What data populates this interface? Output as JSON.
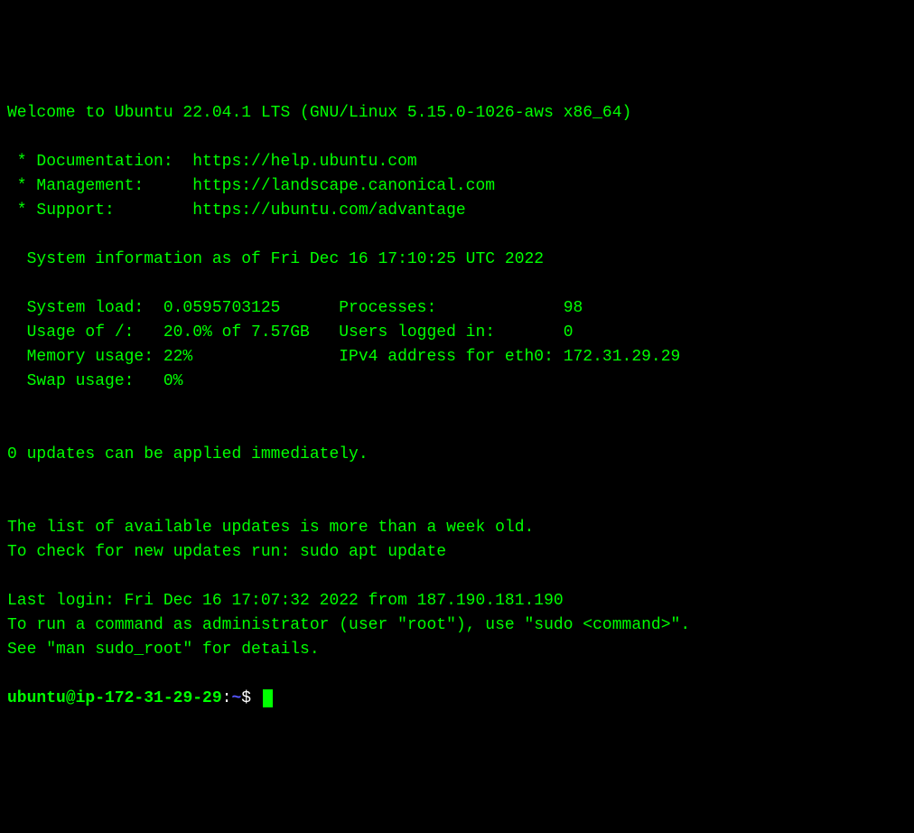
{
  "motd": {
    "welcome": "Welcome to Ubuntu 22.04.1 LTS (GNU/Linux 5.15.0-1026-aws x86_64)",
    "doc_line": " * Documentation:  https://help.ubuntu.com",
    "mgmt_line": " * Management:     https://landscape.canonical.com",
    "support_line": " * Support:        https://ubuntu.com/advantage",
    "sysinfo_header": "  System information as of Fri Dec 16 17:10:25 UTC 2022",
    "row1": "  System load:  0.0595703125      Processes:             98",
    "row2": "  Usage of /:   20.0% of 7.57GB   Users logged in:       0",
    "row3": "  Memory usage: 22%               IPv4 address for eth0: 172.31.29.29",
    "row4": "  Swap usage:   0%",
    "updates": "0 updates can be applied immediately.",
    "stale1": "The list of available updates is more than a week old.",
    "stale2": "To check for new updates run: sudo apt update",
    "last_login": "Last login: Fri Dec 16 17:07:32 2022 from 187.190.181.190",
    "sudo1": "To run a command as administrator (user \"root\"), use \"sudo <command>\".",
    "sudo2": "See \"man sudo_root\" for details."
  },
  "prompt": {
    "user": "ubuntu",
    "at": "@",
    "host": "ip-172-31-29-29",
    "colon": ":",
    "path": "~",
    "dollar": "$ "
  }
}
